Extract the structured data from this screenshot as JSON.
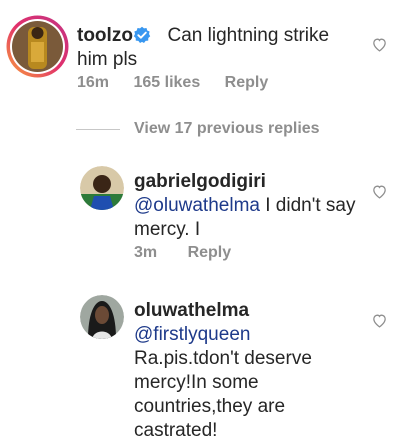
{
  "comment": {
    "username": "toolzo",
    "verified": true,
    "text_line1": "Can lightning strike",
    "text_line2": "him pls",
    "time": "16m",
    "likes": "165 likes",
    "reply": "Reply"
  },
  "view_replies": "View 17 previous replies",
  "replies": [
    {
      "username": "gabrielgodigiri",
      "mention": "@oluwathelma",
      "text_line1": " I didn't say",
      "text_line2": "mercy. I",
      "time": "3m",
      "reply": "Reply"
    },
    {
      "username": "oluwathelma",
      "mention": "@firstlyqueen",
      "text_line1": "Ra.pis.tdon't deserve",
      "text_line2": "mercy!In some",
      "text_line3": "countries,they are",
      "text_line4": "castrated!"
    }
  ],
  "icons": {
    "verified": "verified-badge-icon",
    "like": "heart-icon"
  },
  "colors": {
    "verified": "#3897f0",
    "mention": "#1e3a8a",
    "meta": "#8e8e8e"
  }
}
